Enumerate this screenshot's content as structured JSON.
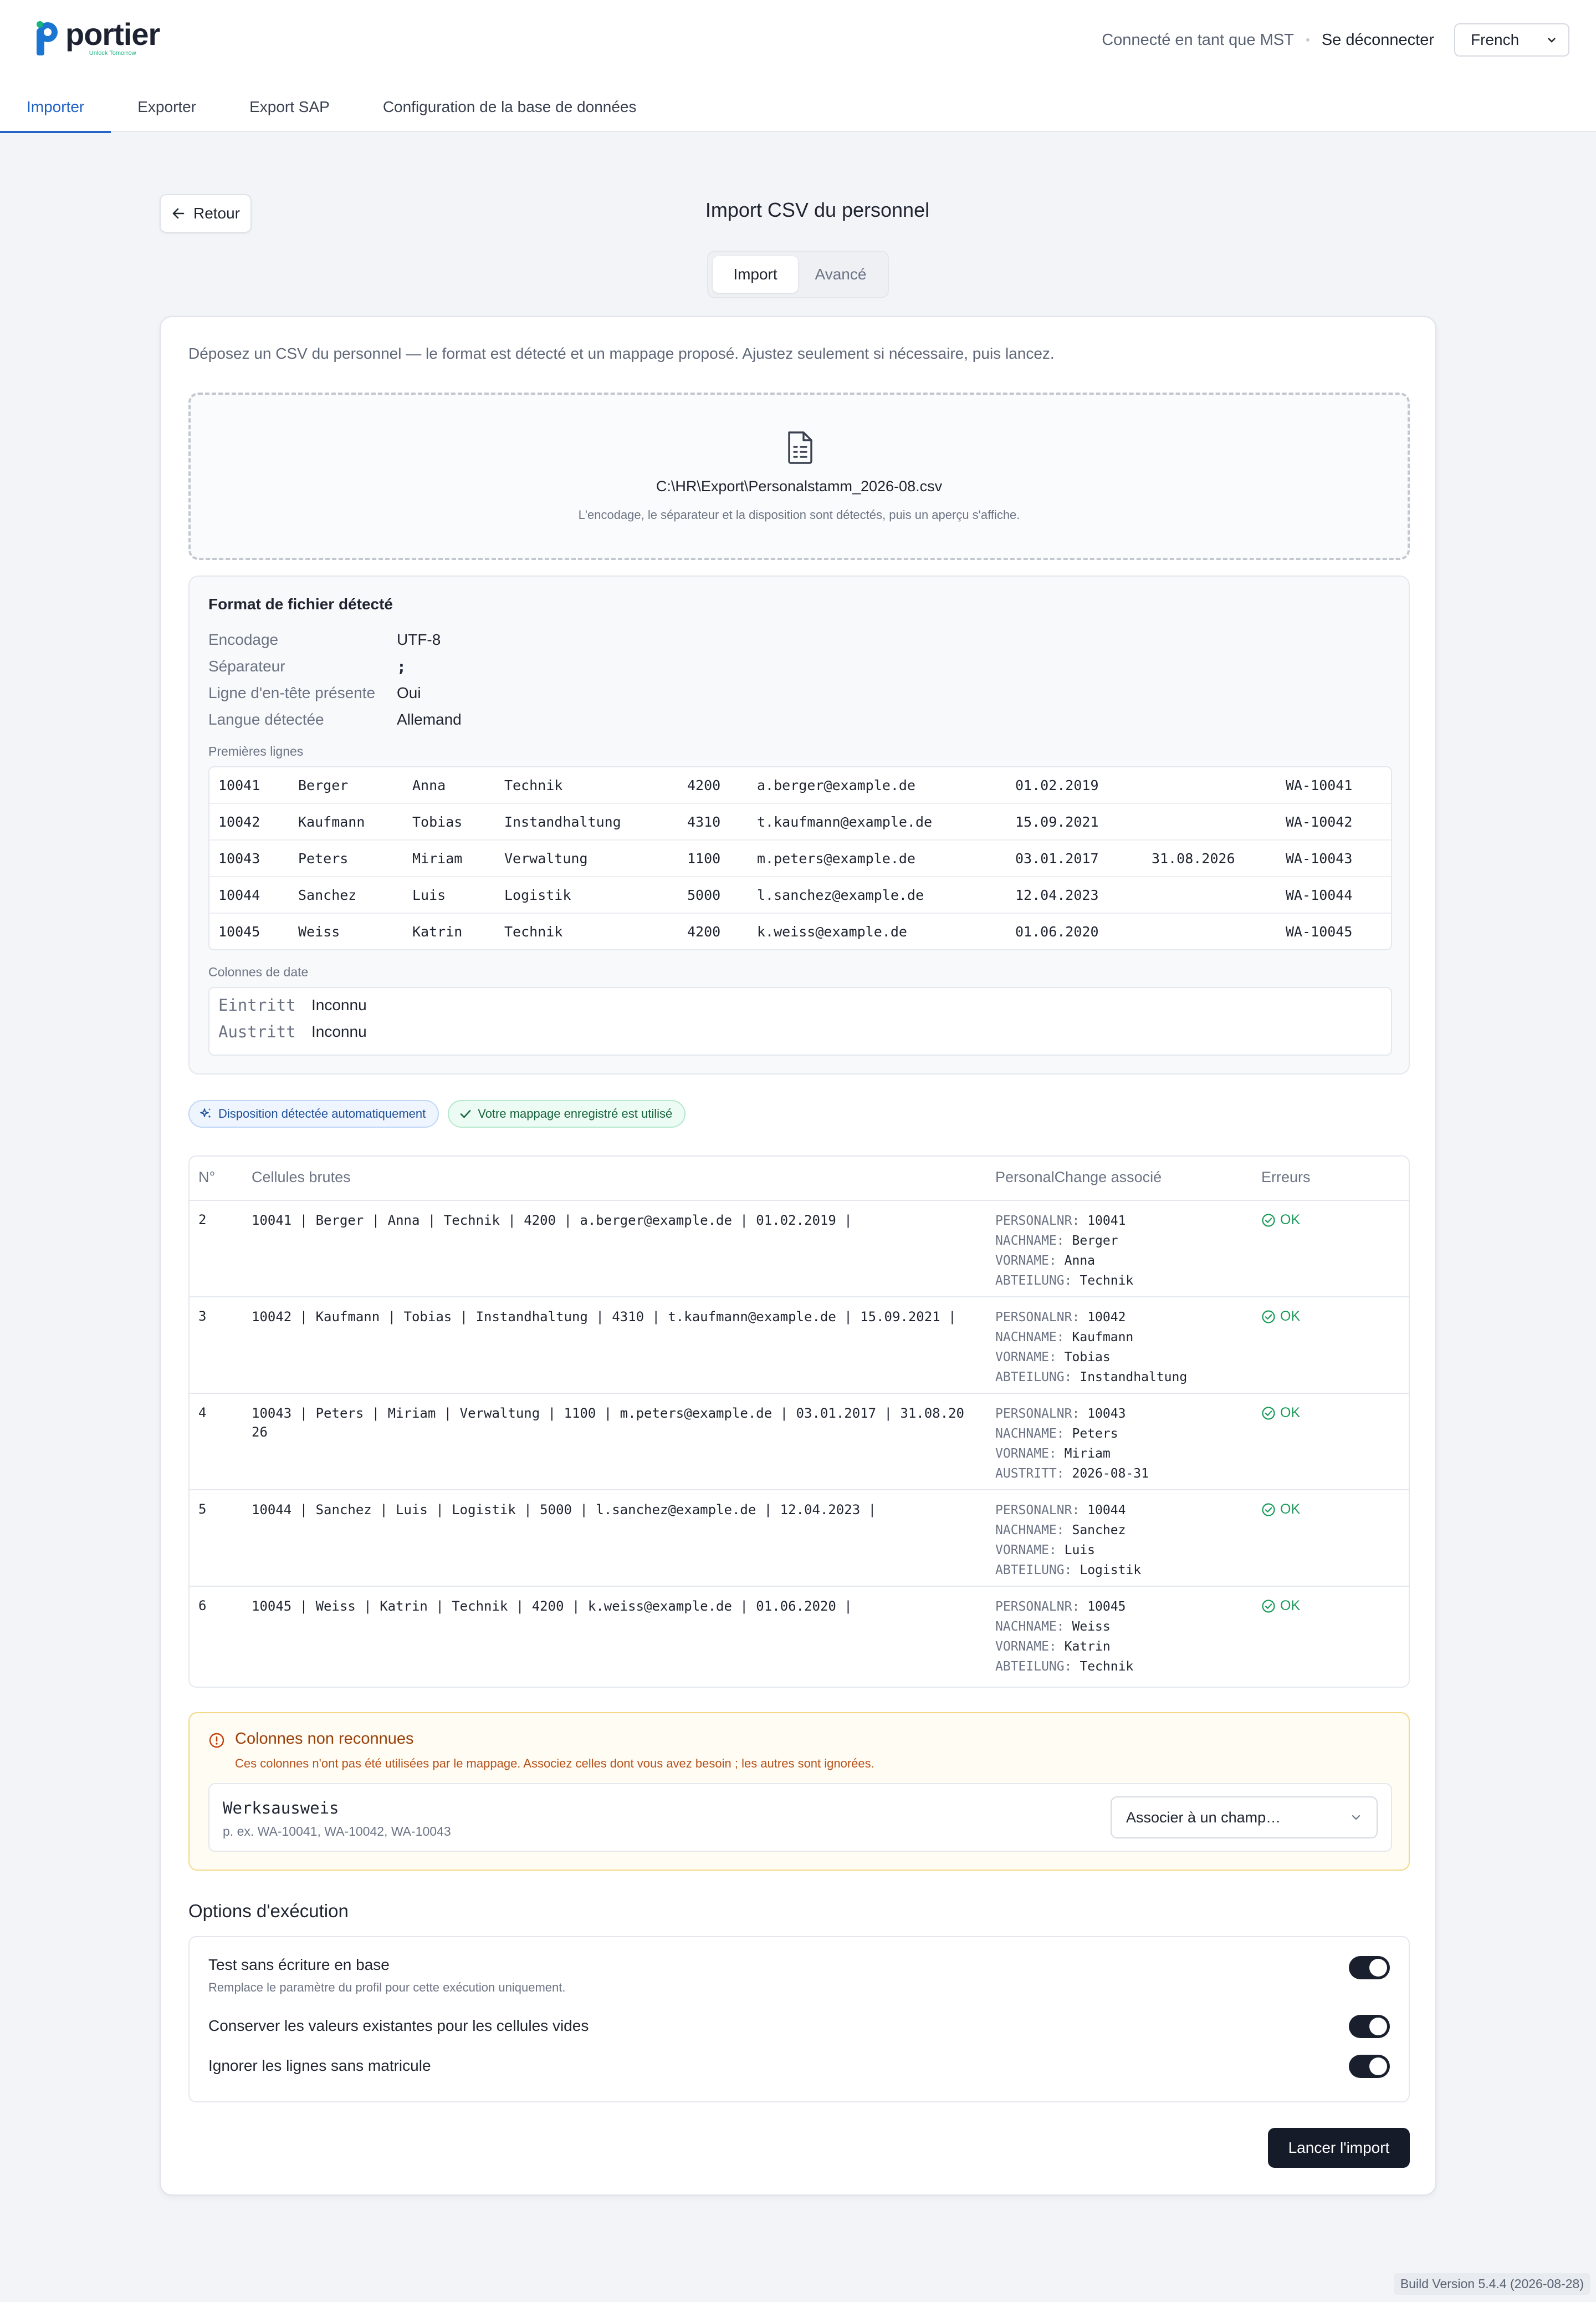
{
  "app": {
    "logo_text": "portier",
    "logo_subtext": "Unlock Tomorrow",
    "brand_color": "#1a76d2",
    "accent_color": "#18b37e"
  },
  "header": {
    "connected_as": "Connecté en tant que MST",
    "logout": "Se déconnecter",
    "language": "French"
  },
  "nav": {
    "tabs": [
      {
        "label": "Importer",
        "active": true
      },
      {
        "label": "Exporter",
        "active": false
      },
      {
        "label": "Export SAP",
        "active": false
      },
      {
        "label": "Configuration de la base de données",
        "active": false
      }
    ]
  },
  "page": {
    "back": "Retour",
    "title": "Import CSV du personnel",
    "mode_tabs": [
      {
        "label": "Import",
        "active": true
      },
      {
        "label": "Avancé",
        "active": false
      }
    ],
    "intro": "Déposez un CSV du personnel — le format est détecté et un mappage proposé. Ajustez seulement si nécessaire, puis lancez."
  },
  "dropzone": {
    "icon": "file-spreadsheet-icon",
    "file_path": "C:\\HR\\Export\\Personalstamm_2026-08.csv",
    "hint": "L'encodage, le séparateur et la disposition sont détectés, puis un aperçu s'affiche."
  },
  "format": {
    "title": "Format de fichier détecté",
    "fields": [
      {
        "key": "Encodage",
        "value": "UTF-8"
      },
      {
        "key": "Séparateur",
        "value": ";"
      },
      {
        "key": "Ligne d'en-tête présente",
        "value": "Oui"
      },
      {
        "key": "Langue détectée",
        "value": "Allemand"
      }
    ],
    "first_lines_label": "Premières lignes",
    "first_lines": [
      [
        "10041",
        "Berger",
        "Anna",
        "Technik",
        "4200",
        "a.berger@example.de",
        "01.02.2019",
        "",
        "WA-10041"
      ],
      [
        "10042",
        "Kaufmann",
        "Tobias",
        "Instandhaltung",
        "4310",
        "t.kaufmann@example.de",
        "15.09.2021",
        "",
        "WA-10042"
      ],
      [
        "10043",
        "Peters",
        "Miriam",
        "Verwaltung",
        "1100",
        "m.peters@example.de",
        "03.01.2017",
        "31.08.2026",
        "WA-10043"
      ],
      [
        "10044",
        "Sanchez",
        "Luis",
        "Logistik",
        "5000",
        "l.sanchez@example.de",
        "12.04.2023",
        "",
        "WA-10044"
      ],
      [
        "10045",
        "Weiss",
        "Katrin",
        "Technik",
        "4200",
        "k.weiss@example.de",
        "01.06.2020",
        "",
        "WA-10045"
      ]
    ],
    "date_columns_label": "Colonnes de date",
    "date_columns": [
      {
        "name": "Eintritt",
        "format": "Inconnu"
      },
      {
        "name": "Austritt",
        "format": "Inconnu"
      }
    ]
  },
  "chips": {
    "auto_layout": "Disposition détectée automatiquement",
    "saved_mapping": "Votre mappage enregistré est utilisé"
  },
  "mapping_table": {
    "headers": {
      "num": "N°",
      "raw": "Cellules brutes",
      "mapped": "PersonalChange associé",
      "errors": "Erreurs"
    },
    "rows": [
      {
        "num": "2",
        "raw": "10041 | Berger | Anna | Technik | 4200 | a.berger@example.de | 01.02.2019 |",
        "mapped": [
          {
            "k": "PERSONALNR:",
            "v": "10041"
          },
          {
            "k": "NACHNAME:",
            "v": "Berger"
          },
          {
            "k": "VORNAME:",
            "v": "Anna"
          },
          {
            "k": "ABTEILUNG:",
            "v": "Technik"
          }
        ],
        "status": "OK"
      },
      {
        "num": "3",
        "raw": "10042 | Kaufmann | Tobias | Instandhaltung | 4310 | t.kaufmann@example.de | 15.09.2021 |",
        "mapped": [
          {
            "k": "PERSONALNR:",
            "v": "10042"
          },
          {
            "k": "NACHNAME:",
            "v": "Kaufmann"
          },
          {
            "k": "VORNAME:",
            "v": "Tobias"
          },
          {
            "k": "ABTEILUNG:",
            "v": "Instandhaltung"
          }
        ],
        "status": "OK"
      },
      {
        "num": "4",
        "raw": "10043 | Peters | Miriam | Verwaltung | 1100 | m.peters@example.de | 03.01.2017 | 31.08.2026",
        "mapped": [
          {
            "k": "PERSONALNR:",
            "v": "10043"
          },
          {
            "k": "NACHNAME:",
            "v": "Peters"
          },
          {
            "k": "VORNAME:",
            "v": "Miriam"
          },
          {
            "k": "AUSTRITT:",
            "v": "2026-08-31"
          }
        ],
        "status": "OK"
      },
      {
        "num": "5",
        "raw": "10044 | Sanchez | Luis | Logistik | 5000 | l.sanchez@example.de | 12.04.2023 |",
        "mapped": [
          {
            "k": "PERSONALNR:",
            "v": "10044"
          },
          {
            "k": "NACHNAME:",
            "v": "Sanchez"
          },
          {
            "k": "VORNAME:",
            "v": "Luis"
          },
          {
            "k": "ABTEILUNG:",
            "v": "Logistik"
          }
        ],
        "status": "OK"
      },
      {
        "num": "6",
        "raw": "10045 | Weiss | Katrin | Technik | 4200 | k.weiss@example.de | 01.06.2020 |",
        "mapped": [
          {
            "k": "PERSONALNR:",
            "v": "10045"
          },
          {
            "k": "NACHNAME:",
            "v": "Weiss"
          },
          {
            "k": "VORNAME:",
            "v": "Katrin"
          },
          {
            "k": "ABTEILUNG:",
            "v": "Technik"
          }
        ],
        "status": "OK"
      }
    ]
  },
  "unrecognized": {
    "title": "Colonnes non reconnues",
    "description": "Ces colonnes n'ont pas été utilisées par le mappage. Associez celles dont vous avez besoin ; les autres sont ignorées.",
    "column_name": "Werksausweis",
    "examples": "p. ex. WA-10041, WA-10042, WA-10043",
    "select_placeholder": "Associer à un champ…"
  },
  "options": {
    "title": "Options d'exécution",
    "items": [
      {
        "label": "Test sans écriture en base",
        "description": "Remplace le paramètre du profil pour cette exécution uniquement.",
        "on": true
      },
      {
        "label": "Conserver les valeurs existantes pour les cellules vides",
        "on": true
      },
      {
        "label": "Ignorer les lignes sans matricule",
        "on": true
      }
    ]
  },
  "actions": {
    "launch": "Lancer l'import"
  },
  "footer": {
    "build": "Build Version 5.4.4 (2026-08-28)"
  }
}
